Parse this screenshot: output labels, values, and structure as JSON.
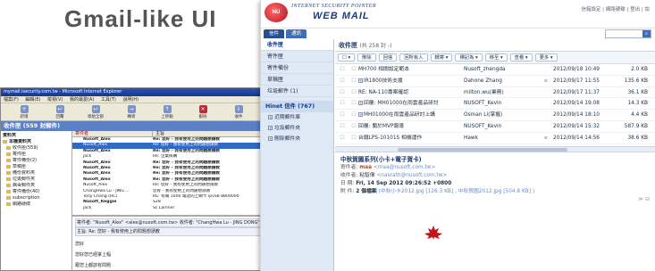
{
  "headline": "Gmail-like UI",
  "outlook": {
    "title": "mymail.isecurity.com.tw - Microsoft Internet Explorer",
    "menu": [
      "檔案(F)",
      "編輯(E)",
      "檢視(V)",
      "我的最愛(A)",
      "工具(T)",
      "說明(H)"
    ],
    "toolbar": [
      "新增",
      "回覆",
      "寄給全部",
      "轉寄",
      "上移動",
      "刪除",
      "收件"
    ],
    "folder_header": "收件匣 (559 封郵件)",
    "tree": [
      {
        "label": "資料夾",
        "root": true
      },
      {
        "label": "本機資料夾",
        "root": true
      },
      {
        "label": "收件匣(559)"
      },
      {
        "label": "寄件匣"
      },
      {
        "label": "寄件備份(2)"
      },
      {
        "label": "草稿匣"
      },
      {
        "label": "備份資料夾"
      },
      {
        "label": "垃圾郵件夾"
      },
      {
        "label": "病毒郵件夾"
      },
      {
        "label": "寄件備份(40)"
      },
      {
        "label": "subscription"
      },
      {
        "label": "網路硬碟"
      }
    ],
    "list_header": {
      "from": "寄件者",
      "subject": "主旨"
    },
    "rows": [
      {
        "from": "Nusoft_Alex",
        "subject": "Re: 您好 - 我有使用上的問題想請教"
      },
      {
        "from": "Nusoft_Alex",
        "subject": "Re: 您好 - 我有使用上的問題想請教",
        "selected": true
      },
      {
        "from": "Nusoft_Alex",
        "subject": "Re: 您好 - 我有使用上的問題想請教"
      },
      {
        "from": "jack",
        "subject": "Re: 企業採購"
      },
      {
        "from": "Nusoft_Alex",
        "subject": "Re: 您好 - 我有使用上的問題想請教"
      },
      {
        "from": "Nusoft_Alex",
        "subject": "Re: 您好 - 我有使用上的問題想請教"
      },
      {
        "from": "Nusoft_Alex",
        "subject": "Re: 您好 - 我有使用上的問題想請教"
      },
      {
        "from": "Nusoft_Alex",
        "subject": "Re: 您好 - 我有使用上的問題想請教"
      },
      {
        "from": "Nusoft_Alex",
        "subject": "Re: 您好 - 我有使用上的問題想請教"
      },
      {
        "from": "ChangHwa Lu - JING ...",
        "subject": "您好 - 我有使用上的問題想請教"
      },
      {
        "from": "Tony Chang (HC)",
        "subject": "RE: 有關 1000 電話的上網卡 ipvS8 8800000"
      },
      {
        "from": "Nusoft_Reggie",
        "subject": "S28"
      },
      {
        "from": "jack",
        "subject": "Sc Lamner"
      }
    ],
    "preview": {
      "header": "寄件者: \"Nusoft_Alex\" <alex@nusoft.com.tw>   收件者: \"ChangHwa Lu - JING DONG\"",
      "subject_line": "主旨: Re: 您好 - 我有使用上的問題想請教",
      "lines": [
        "您好",
        "您好您已經掌上幅",
        "跟您上都該有問題"
      ]
    }
  },
  "webmail": {
    "brand_top": "INTERNET SECURITY POINTER",
    "brand_main": "WEB MAIL",
    "logo_text": "NU",
    "toplinks": "信箱設定 | 網路硬碟 | 登出 | 說",
    "tabs": [
      "信件",
      "通訊"
    ],
    "search_placeholder": "搜尋",
    "nav": [
      {
        "label": "收件匣",
        "active": true
      },
      {
        "label": "寄件匣"
      },
      {
        "label": "寄件備份"
      },
      {
        "label": "草稿匣"
      },
      {
        "label": "垃圾郵件 (1)"
      }
    ],
    "group": "Hinet 信件 (767)",
    "subfolders": [
      "近期郵件庫",
      "垃圾郵件夾",
      "刪除郵件夾"
    ],
    "folder_title": "收件匣",
    "folder_count": "(共 258 封 -)",
    "toolbar": [
      "▾",
      "刪除",
      "回信",
      "回所有人",
      "轉寄 ▾",
      "標記為 ▾",
      "移至 ▾",
      "查看 ▾",
      "更多 ▾"
    ],
    "messages": [
      {
        "subject": "MH700 相關設定範本",
        "from": "Nusoft_zhengda",
        "attach": false,
        "date": "2012/09/18 10:49",
        "size": "2.0 KB"
      },
      {
        "subject": "IR1800技術支援",
        "from": "Dahone Zhang",
        "attach": true,
        "date": "2012/09/17 11:55",
        "size": "135.6 KB",
        "badge": true
      },
      {
        "subject": "RE: NA-110專案確認",
        "from": "milton.wu(業務)",
        "attach": false,
        "date": "2012/09/17 11:37",
        "size": "36.1 KB"
      },
      {
        "subject": "回覆: MH01000在雨雲產品研討",
        "from": "NUSOFT_Kevin",
        "attach": false,
        "date": "2012/09/14 19:08",
        "size": "14.3 KB",
        "badge": true
      },
      {
        "subject": "MH01000在雨雲產品研討上講",
        "from": "Osman Li(掌握)",
        "attach": false,
        "date": "2012/09/14 18:10",
        "size": "4.4 KB",
        "badge": true
      },
      {
        "subject": "回覆: 蘭於MVP報導",
        "from": "NUSOFT_Kevin",
        "attach": false,
        "date": "2012/09/14 15:32",
        "size": "587.9 KB"
      },
      {
        "subject": "台鐵LPS-10101S 相機運作",
        "from": "Hawk",
        "attach": true,
        "date": "2012/09/14 14:56",
        "size": "38.6 KB"
      }
    ],
    "preview": {
      "title": "中秋賀圖系列(小卡+電子賀卡)",
      "from_label": "寄件者:",
      "from_name": "maa",
      "from_addr": "<maa@nusoft.com.tw>",
      "to_label": "收件者:",
      "to_name": "粘智偉",
      "to_addr": "<nasrath@nusoft.com.tw>",
      "date_label": "日 期:",
      "date": "Fri, 14 Sep 2012 09:26:52 +0800",
      "att_label": "附 件:",
      "att_count": "2 個檔案",
      "att_files": "(中秋小卡2012.jpg [126.3 KB] , 中秋賀圖2012.jpg [504.8 KB] )"
    }
  }
}
